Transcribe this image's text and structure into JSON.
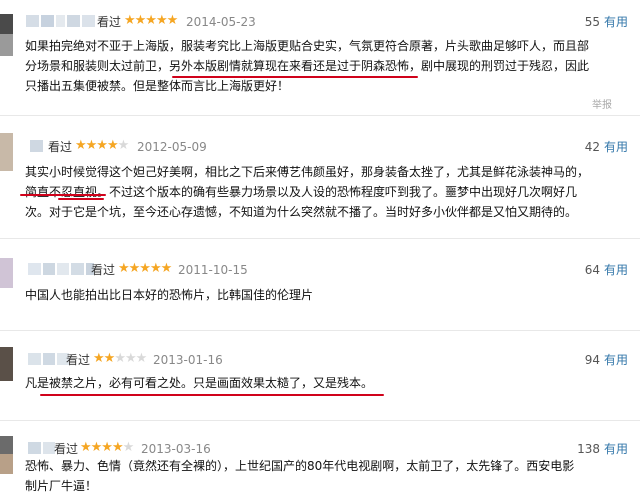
{
  "reviews": [
    {
      "action": "看过",
      "stars": 5,
      "date": "2014-05-23",
      "votes": "55",
      "useful": "有用",
      "lines": [
        "如果拍完绝对不亚于上海版，服装考究比上海版更贴合史实，气氛更符合原著，片头歌曲足够吓人，而且部",
        "分场景和服装则太过前卫，另外本版剧情就算现在来看还是过于阴森恐怖，剧中展现的刑罚过于残忍，因此",
        "只播出五集便被禁。但是整体而言比上海版更好！"
      ],
      "report": "举报"
    },
    {
      "action": "看过",
      "stars": 4,
      "date": "2012-05-09",
      "votes": "42",
      "useful": "有用",
      "lines": [
        "其实小时候觉得这个妲己好美啊，相比之下后来傅艺伟颜虽好，那身装备太挫了，尤其是鲜花泳装神马的，",
        "简直不忍直视。不过这个版本的确有些暴力场景以及人设的恐怖程度吓到我了。噩梦中出现好几次啊好几",
        "次。对于它是个坑，至今还心存遗憾，不知道为什么突然就不播了。当时好多小伙伴都是又怕又期待的。"
      ]
    },
    {
      "action": "看过",
      "stars": 5,
      "date": "2011-10-15",
      "votes": "64",
      "useful": "有用",
      "lines": [
        "中国人也能拍出比日本好的恐怖片，比韩国佳的伦理片"
      ]
    },
    {
      "action": "看过",
      "stars": 2,
      "date": "2013-01-16",
      "votes": "94",
      "useful": "有用",
      "lines": [
        "凡是被禁之片，必有可看之处。只是画面效果太糙了，又是残本。"
      ]
    },
    {
      "action": "看过",
      "stars": 4,
      "date": "2013-03-16",
      "votes": "138",
      "useful": "有用",
      "lines": [
        "恐怖、暴力、色情（竟然还有全裸的），上世纪国产的80年代电视剧啊，太前卫了，太先锋了。西安电影",
        "制片厂牛逼！"
      ]
    }
  ],
  "colors": {
    "accent_link": "#3377aa",
    "star_on": "#f5a623",
    "star_off": "#d9d9d9",
    "underline": "#d0021b"
  }
}
